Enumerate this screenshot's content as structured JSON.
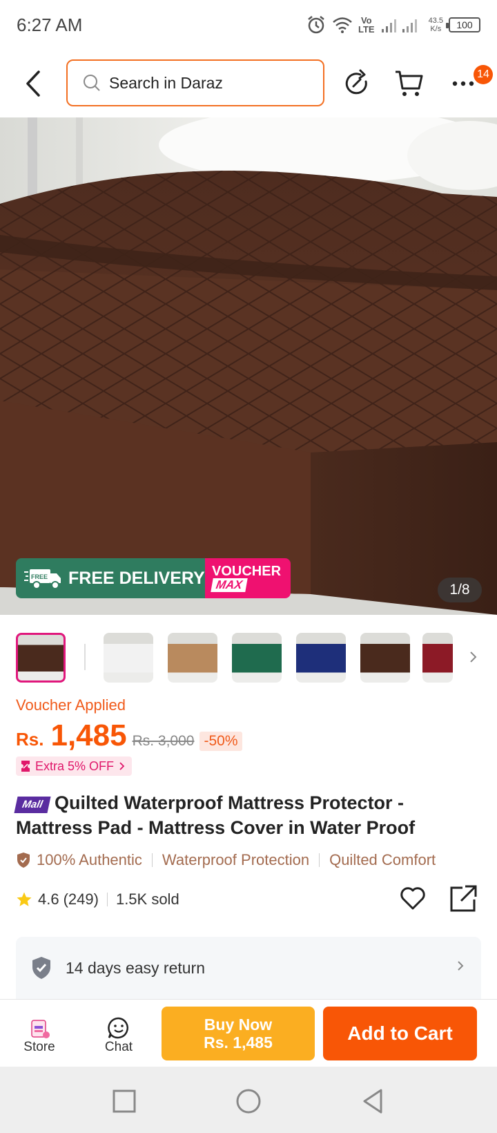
{
  "status_bar": {
    "time": "6:27 AM",
    "net_speed_value": "43.5",
    "net_speed_unit": "K/s",
    "battery": "100",
    "network_label_top": "Vo",
    "network_label_bottom": "LTE"
  },
  "header": {
    "search_placeholder": "Search in Daraz",
    "menu_badge": "14"
  },
  "gallery": {
    "promo_left": "FREE DELIVERY",
    "promo_left_icon_text": "FREE",
    "promo_right_top": "VOUCHER",
    "promo_right_bottom": "MAX",
    "counter": "1/8",
    "thumbnails": [
      {
        "color": "#4a2a1d",
        "active": true
      },
      {
        "color": "#f2f2f2",
        "active": false
      },
      {
        "color": "#b98a5e",
        "active": false
      },
      {
        "color": "#1f6b4e",
        "active": false
      },
      {
        "color": "#1e2f7a",
        "active": false
      },
      {
        "color": "#4a2a1d",
        "active": false
      },
      {
        "color": "#8c1a26",
        "active": false
      }
    ]
  },
  "price": {
    "voucher_applied": "Voucher Applied",
    "currency": "Rs.",
    "current": "1,485",
    "original": "Rs. 3,000",
    "discount": "-50%",
    "extra_off": "Extra 5% OFF"
  },
  "product": {
    "mall_badge": "Mall",
    "title": "Quilted Waterproof Mattress Protector - Mattress Pad - Mattress Cover in Water Proof",
    "features": [
      "100% Authentic",
      "Waterproof Protection",
      "Quilted Comfort"
    ],
    "rating": "4.6",
    "reviews": "(249)",
    "sold": "1.5K sold"
  },
  "return_policy": {
    "label": "14 days easy return"
  },
  "bottom_bar": {
    "store_label": "Store",
    "chat_label": "Chat",
    "buy_now_label": "Buy Now",
    "buy_now_price": "Rs. 1,485",
    "add_to_cart_label": "Add to Cart"
  },
  "colors": {
    "accent": "#f85606",
    "buy_now": "#fbae21",
    "free_delivery": "#2f7c5f",
    "voucher_max": "#ef1170"
  }
}
